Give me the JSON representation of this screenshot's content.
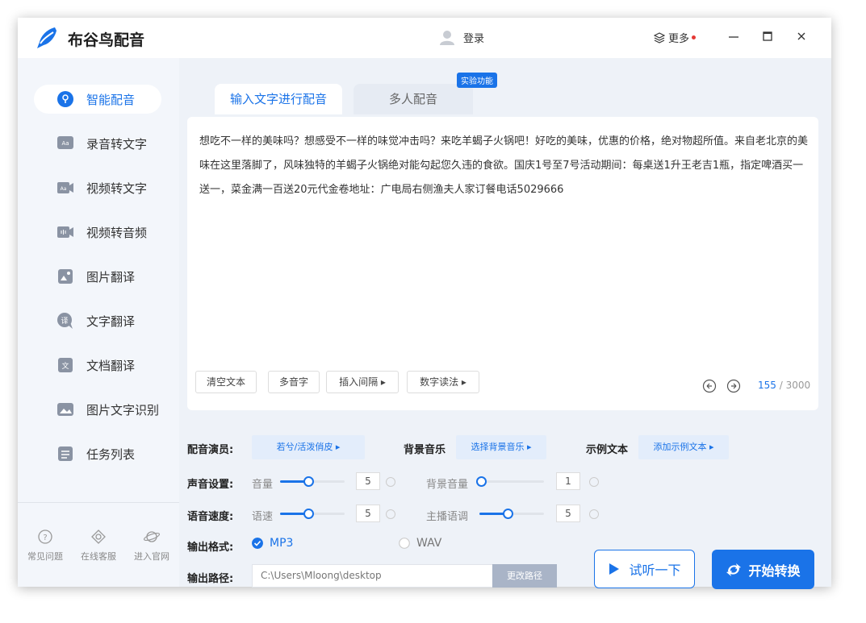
{
  "app": {
    "title": "布谷鸟配音",
    "accent": "#1a73e8"
  },
  "titlebar": {
    "login_label": "登录",
    "more_label": "更多"
  },
  "sidebar": {
    "items": [
      {
        "label": "智能配音",
        "icon": "smart-dubbing-icon"
      },
      {
        "label": "录音转文字",
        "icon": "audio-to-text-icon"
      },
      {
        "label": "视频转文字",
        "icon": "video-to-text-icon"
      },
      {
        "label": "视频转音频",
        "icon": "video-to-audio-icon"
      },
      {
        "label": "图片翻译",
        "icon": "image-translate-icon"
      },
      {
        "label": "文字翻译",
        "icon": "text-translate-icon"
      },
      {
        "label": "文档翻译",
        "icon": "document-translate-icon"
      },
      {
        "label": "图片文字识别",
        "icon": "ocr-icon"
      },
      {
        "label": "任务列表",
        "icon": "task-list-icon"
      }
    ],
    "footer": [
      {
        "label": "常见问题",
        "icon": "help-icon"
      },
      {
        "label": "在线客服",
        "icon": "support-icon"
      },
      {
        "label": "进入官网",
        "icon": "website-icon"
      }
    ]
  },
  "tabs": {
    "text_dubbing": "输入文字进行配音",
    "multi_dubbing": "多人配音",
    "lab_badge": "实验功能"
  },
  "editor": {
    "text": "想吃不一样的美味吗？想感受不一样的味觉冲击吗？来吃羊蝎子火锅吧！好吃的美味，优惠的价格，绝对物超所值。来自老北京的美味在这里落脚了，风味独特的羊蝎子火锅绝对能勾起您久违的食欲。国庆1号至7号活动期间：每桌送1升王老吉1瓶，指定啤酒买一送一，菜金满一百送20元代金卷地址：广电局右侧渔夫人家订餐电话5029666",
    "clear_btn": "清空文本",
    "polyphone_btn": "多音字",
    "insert_pause_btn": "插入间隔 ▸",
    "number_read_btn": "数字读法 ▸",
    "char_count": "155",
    "char_max": "/ 3000"
  },
  "settings": {
    "voice_label": "配音演员:",
    "voice_value": "若兮/活泼俏皮  ▸",
    "bgm_label": "背景音乐",
    "bgm_value": "选择背景音乐 ▸",
    "sample_label": "示例文本",
    "sample_value": "添加示例文本 ▸",
    "sound_label": "声音设置:",
    "volume_label": "音量",
    "volume_value": "5",
    "bg_volume_label": "背景音量",
    "bg_volume_value": "1",
    "speed_label": "语音速度:",
    "speed_sub_label": "语速",
    "speed_value": "5",
    "pitch_label": "主播语调",
    "pitch_value": "5",
    "format_label": "输出格式:",
    "format_mp3": "MP3",
    "format_wav": "WAV",
    "path_label": "输出路径:",
    "path_value": "C:\\Users\\Mloong\\desktop",
    "change_path_btn": "更改路径"
  },
  "actions": {
    "listen_btn": "试听一下",
    "start_btn": "开始转换"
  }
}
